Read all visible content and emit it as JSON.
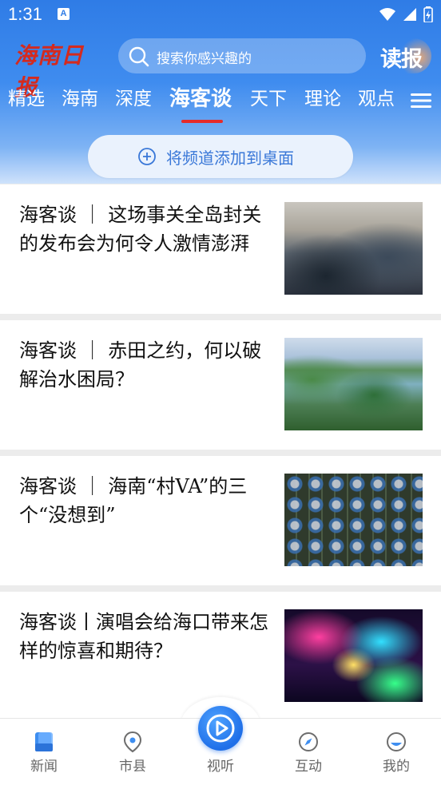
{
  "status_bar": {
    "time": "1:31",
    "notification_badge": "A"
  },
  "header": {
    "logo_text": "海南日报",
    "search_placeholder": "搜索你感兴趣的",
    "dubao_label": "读报"
  },
  "tabs": [
    {
      "label": "精选"
    },
    {
      "label": "海南"
    },
    {
      "label": "深度"
    },
    {
      "label": "海客谈",
      "active": true
    },
    {
      "label": "天下"
    },
    {
      "label": "理论"
    },
    {
      "label": "观点"
    }
  ],
  "add_channel_label": "将频道添加到桌面",
  "articles": [
    {
      "title": "海客谈 ｜ 这场事关全岛封关的发布会为何令人激情澎湃"
    },
    {
      "title": "海客谈 ｜ 赤田之约，何以破解治水困局？"
    },
    {
      "title": "海客谈 ｜ 海南“村VA”的三个“没想到”"
    },
    {
      "title": "海客谈丨演唱会给海口带来怎样的惊喜和期待？"
    }
  ],
  "bottom_nav": [
    {
      "label": "新闻",
      "icon": "news-icon",
      "active": true
    },
    {
      "label": "市县",
      "icon": "location-icon"
    },
    {
      "label": "视听",
      "icon": "play-icon"
    },
    {
      "label": "互动",
      "icon": "compass-icon"
    },
    {
      "label": "我的",
      "icon": "profile-icon"
    }
  ],
  "colors": {
    "header_blue": "#2f7ce6",
    "tab_indicator": "#e42b2b",
    "logo_red": "#d42a1e",
    "accent_blue": "#3a78d8"
  }
}
